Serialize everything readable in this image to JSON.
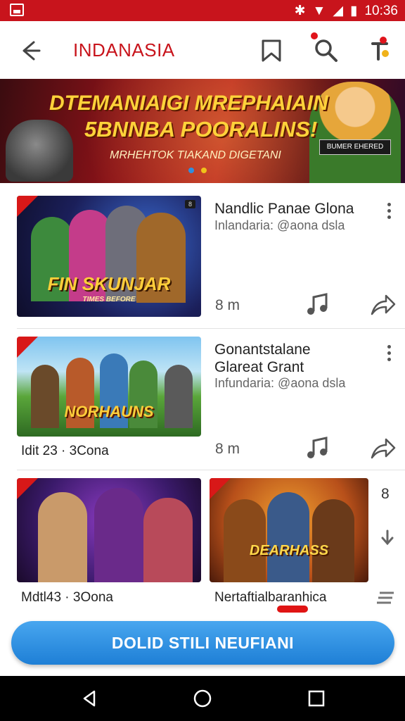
{
  "status_bar": {
    "time": "10:36"
  },
  "app_bar": {
    "title": "INDANASIA"
  },
  "banner": {
    "headline_1": "DTEMANIAIGI MREPHAIAIN",
    "headline_2": "5BNNBA POORALINS!",
    "subtitle": "MRHEHTOK TIAKAND DIGETANI",
    "chip": "BUMER EHERED",
    "colors": {
      "headline": "#ffd23a"
    }
  },
  "items": [
    {
      "title": "Nandlic Panae Glona",
      "subtitle": "Inlandaria: @aona dsla",
      "duration": "8 m",
      "image_logo": "FIN SKUNJAR",
      "image_tag": "TIMES BEFORE",
      "image_corner": "8"
    },
    {
      "title_line1": "Gonantstalane",
      "title_line2": "Glareat Grant",
      "subtitle": "Infundaria: @aona dsla",
      "duration": "8 m",
      "caption": "Idit 23 · 3Cona",
      "image_logo": "NORHAUNS"
    }
  ],
  "grid": [
    {
      "caption": "Mdtl43 · 3Oona"
    },
    {
      "caption": "Nertaftialbaranhica",
      "side_count": "8",
      "image_logo": "DEARHASS"
    }
  ],
  "cta": {
    "label": "DOLID STILI NEUFIANI"
  },
  "colors": {
    "brand": "#c8141c",
    "cta": "#2f8fe0"
  }
}
